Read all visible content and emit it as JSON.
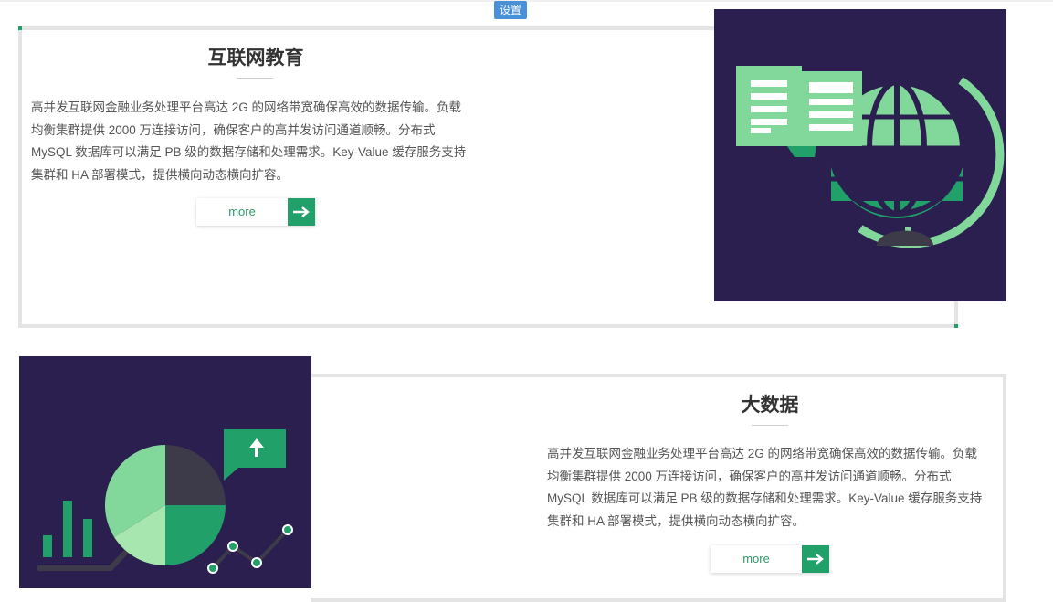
{
  "toolbar": {
    "settings_label": "设置"
  },
  "sections": [
    {
      "title": "互联网教育",
      "description_lines": [
        "高并发互联网金融业务处理平台高达 2G 的网络带宽确保高效的数据传输。负载",
        "均衡集群提供 2000 万连接访问，确保客户的高并发访问通道顺畅。分布式",
        "MySQL 数据库可以满足 PB 级的数据存储和处理需求。Key-Value 缓存服务支持",
        "集群和 HA 部署模式，提供横向动态横向扩容。"
      ],
      "more_label": "more",
      "illustration_icon": "book-globe-illustration"
    },
    {
      "title": "大数据",
      "description_lines": [
        "高并发互联网金融业务处理平台高达 2G 的网络带宽确保高效的数据传输。负载",
        "均衡集群提供 2000 万连接访问，确保客户的高并发访问通道顺畅。分布式",
        "MySQL 数据库可以满足 PB 级的数据存储和处理需求。Key-Value 缓存服务支持",
        "集群和 HA 部署模式，提供横向动态横向扩容。"
      ],
      "more_label": "more",
      "illustration_icon": "pie-chart-illustration"
    }
  ],
  "colors": {
    "accent": "#22a06a",
    "light_green": "#82d89a",
    "illustration_bg": "#2a1f4f",
    "border": "#e4e4e4",
    "settings_badge": "#4a90d9"
  }
}
